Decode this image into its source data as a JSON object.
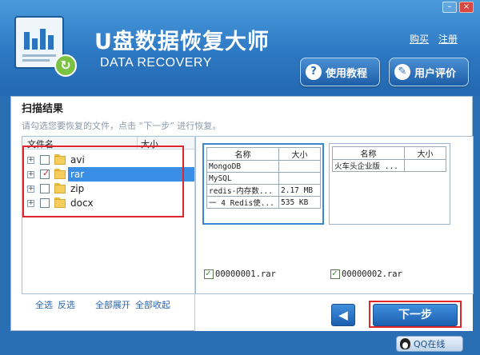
{
  "app": {
    "title": "U盘数据恢复大师",
    "subtitle": "DATA RECOVERY"
  },
  "window_controls": {
    "minimize": "–",
    "close": "×"
  },
  "top_links": {
    "buy": "购买",
    "register": "注册"
  },
  "header_buttons": {
    "tutorial": "使用教程",
    "review": "用户评价"
  },
  "scan": {
    "title": "扫描结果",
    "hint": "请勾选您要恢复的文件，点击 “下一步” 进行恢复。"
  },
  "tree": {
    "col_name": "文件名",
    "col_size": "大小",
    "items": [
      {
        "label": "avi",
        "checked": false,
        "selected": false
      },
      {
        "label": "rar",
        "checked": true,
        "selected": true
      },
      {
        "label": "zip",
        "checked": false,
        "selected": false
      },
      {
        "label": "docx",
        "checked": false,
        "selected": false
      }
    ],
    "actions": {
      "select_all": "全选",
      "invert": "反选",
      "expand_all": "全部展开",
      "collapse_all": "全部收起"
    }
  },
  "preview": {
    "files": [
      {
        "filename": "00000001.rar",
        "checked": true,
        "header_name": "名称",
        "header_size": "大小",
        "rows": [
          {
            "name": "MongoDB",
            "size": ""
          },
          {
            "name": "MySQL",
            "size": ""
          },
          {
            "name": "redis-内存数...",
            "size": "2.17 MB"
          },
          {
            "name": "一 4 Redis使...",
            "size": "535 KB"
          }
        ]
      },
      {
        "filename": "00000002.rar",
        "checked": true,
        "header_name": "名称",
        "header_size": "大小",
        "rows": [
          {
            "name": "火车头企业版 ...",
            "size": ""
          }
        ]
      }
    ]
  },
  "nav": {
    "back": "◀",
    "next": "下一步"
  },
  "footer": {
    "qq": "QQ在线"
  }
}
